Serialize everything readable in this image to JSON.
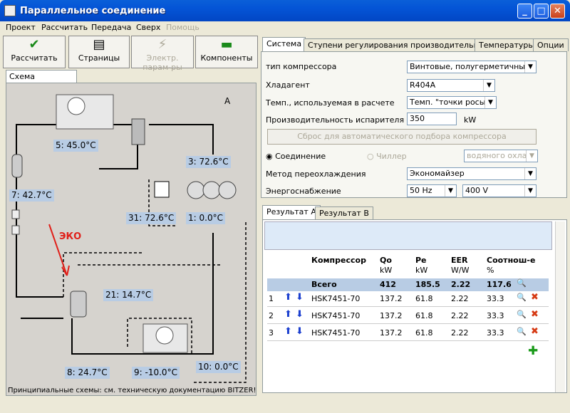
{
  "window": {
    "title": "Параллельное соединение",
    "min": "_",
    "max": "□",
    "close": "✕"
  },
  "menu": [
    "Проект",
    "Рассчитать",
    "Передача",
    "Сверх",
    "Помощь"
  ],
  "toolbar": {
    "calc": "Рассчитать",
    "pages": "Страницы",
    "electr": "Электр. парам-ры",
    "components": "Компоненты"
  },
  "left_tab": "Схема установки",
  "diagram": {
    "corner": "A",
    "eko": "ЭКО",
    "points": [
      {
        "n": "5:",
        "v": "45.0°C"
      },
      {
        "n": "3:",
        "v": "72.6°C"
      },
      {
        "n": "7:",
        "v": "42.7°C"
      },
      {
        "n": "31:",
        "v": "72.6°C"
      },
      {
        "n": "1:",
        "v": "0.0°C"
      },
      {
        "n": "21:",
        "v": "14.7°C"
      },
      {
        "n": "8:",
        "v": "24.7°C"
      },
      {
        "n": "9:",
        "v": "-10.0°C"
      },
      {
        "n": "10:",
        "v": "0.0°C"
      }
    ],
    "footnote": "Принципиальные схемы: см. техническую документацию BITZER!"
  },
  "tabs": [
    "Система",
    "Ступени регулирования производительности",
    "Температуры",
    "Опции"
  ],
  "system": {
    "compressor_type_label": "тип компрессора",
    "compressor_type": "Винтовые, полугерметичные",
    "refrigerant_label": "Хладагент",
    "refrigerant": "R404A",
    "temp_label": "Темп., используемая в расчете",
    "temp": "Темп. \"точки росы\"",
    "capacity_label": "Производительность испарителя",
    "capacity": "350",
    "capacity_unit": "kW",
    "reset": "Сброс для автоматического подбора компрессора",
    "radio_connection": "Соединение",
    "radio_chiller": "Чиллер",
    "cooling": "водяного охлаж",
    "subcool_label": "Метод переохлаждения",
    "subcool": "Экономайзер",
    "power_label": "Энергоснабжение",
    "freq": "50 Hz",
    "voltage": "400 V"
  },
  "result_tabs": [
    "Результат A",
    "Результат B"
  ],
  "results": {
    "headers": {
      "comp": "Компрессор",
      "qo": "Qo",
      "pe": "Pe",
      "eer": "EER",
      "ratio": "Соотнош-е"
    },
    "units": {
      "qo": "kW",
      "pe": "kW",
      "eer": "W/W",
      "ratio": "%"
    },
    "total": {
      "label": "Всего",
      "qo": "412",
      "pe": "185.5",
      "eer": "2.22",
      "ratio": "117.6"
    },
    "rows": [
      {
        "n": "1",
        "model": "HSK7451-70",
        "qo": "137.2",
        "pe": "61.8",
        "eer": "2.22",
        "ratio": "33.3"
      },
      {
        "n": "2",
        "model": "HSK7451-70",
        "qo": "137.2",
        "pe": "61.8",
        "eer": "2.22",
        "ratio": "33.3"
      },
      {
        "n": "3",
        "model": "HSK7451-70",
        "qo": "137.2",
        "pe": "61.8",
        "eer": "2.22",
        "ratio": "33.3"
      }
    ]
  }
}
